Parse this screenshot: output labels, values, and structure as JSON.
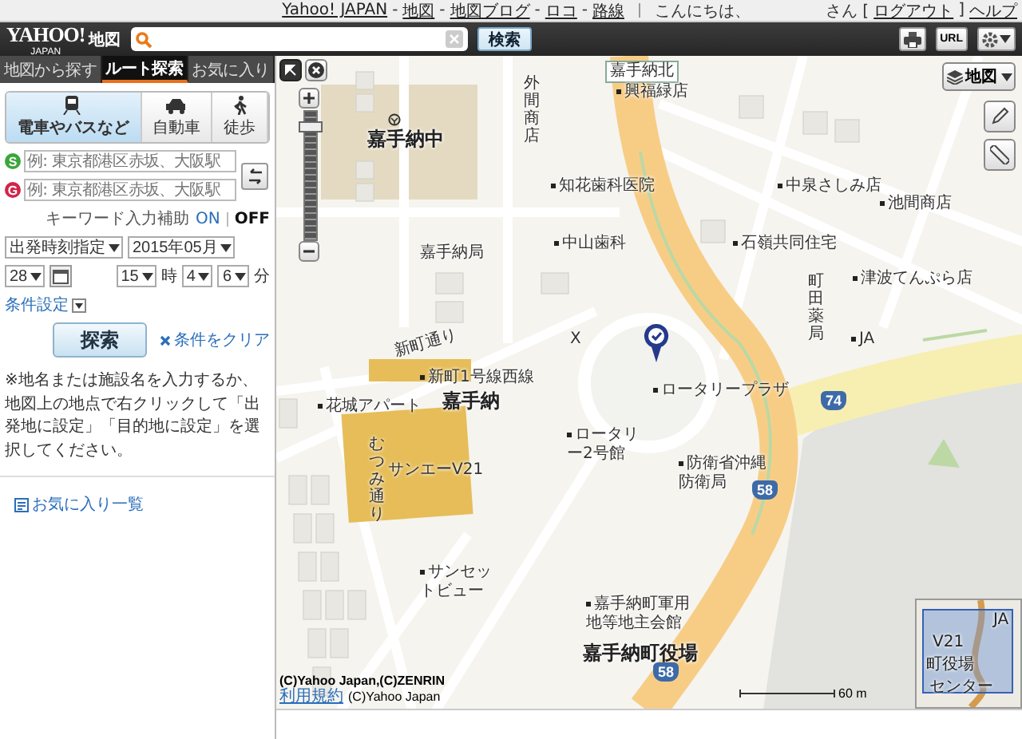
{
  "top_bar": {
    "links": [
      "Yahoo! JAPAN",
      "地図",
      "地図ブログ",
      "ロコ",
      "路線"
    ],
    "link_separator": "-",
    "greeting": "こんにちは、",
    "user_suffix": "さん [",
    "logout": "ログアウト",
    "after_logout": "]",
    "help": "ヘルプ"
  },
  "header": {
    "logo": "YAHOO!",
    "logo_sub": "JAPAN",
    "service": "地図",
    "search_button": "検索",
    "url_button": "URL"
  },
  "sidebar": {
    "tabs": [
      {
        "label": "地図から探す",
        "selected": false
      },
      {
        "label": "ルート探索",
        "selected": true
      },
      {
        "label": "お気に入り",
        "selected": false
      }
    ],
    "modes": [
      {
        "label": "電車やバスなど",
        "kind": "train",
        "selected": true
      },
      {
        "label": "自動車",
        "kind": "car",
        "selected": false
      },
      {
        "label": "徒歩",
        "kind": "walk",
        "selected": false
      }
    ],
    "origin": {
      "mark": "S",
      "placeholder": "例: 東京都港区赤坂、大阪駅"
    },
    "destination": {
      "mark": "G",
      "placeholder": "例: 東京都港区赤坂、大阪駅"
    },
    "keyword_assist": {
      "label": "キーワード入力補助",
      "options": [
        {
          "label": "ON",
          "selected": false
        },
        {
          "label": "OFF",
          "selected": true
        }
      ]
    },
    "time": {
      "mode": "出発時刻指定",
      "month": "2015年05月",
      "day": "28",
      "hour": "15",
      "hour_unit": "時",
      "minute_tens": "4",
      "minute_ones": "6",
      "minute_unit": "分"
    },
    "conditions_link": "条件設定",
    "search_button": "探索",
    "clear_link": "条件をクリア",
    "note": "※地名または施設名を入力するか、地図上の地点で右クリックして「出発地に設定」「目的地に設定」を選択してください。",
    "favorites_link": "お気に入り一覧"
  },
  "map": {
    "layer_button": "地図",
    "zoom": {
      "level": 0.92
    },
    "labels": [
      {
        "text": "嘉手納北",
        "kind": "sign"
      },
      {
        "text": "興福緑店",
        "kind": "poi"
      },
      {
        "text": "嘉手納中",
        "kind": "area"
      },
      {
        "text": "外間商店",
        "kind": "vertical"
      },
      {
        "text": "知花歯科医院",
        "kind": "poi"
      },
      {
        "text": "中泉さしみ店",
        "kind": "poi"
      },
      {
        "text": "池間商店",
        "kind": "poi"
      },
      {
        "text": "中山歯科",
        "kind": "poi"
      },
      {
        "text": "石嶺共同住宅",
        "kind": "poi"
      },
      {
        "text": "嘉手納局",
        "kind": "plain"
      },
      {
        "text": "町田薬局",
        "kind": "vertical"
      },
      {
        "text": "津波てんぷら店",
        "kind": "poi"
      },
      {
        "text": "JA",
        "kind": "poi"
      },
      {
        "text": "新町通り",
        "kind": "road"
      },
      {
        "text": "新町1号線西線",
        "kind": "poi"
      },
      {
        "text": "X",
        "kind": "plain"
      },
      {
        "text": "ロータリープラザ",
        "kind": "poi"
      },
      {
        "text": "花城アパート",
        "kind": "poi"
      },
      {
        "text": "嘉手納",
        "kind": "area"
      },
      {
        "text": "むつみ通り",
        "kind": "vertical"
      },
      {
        "text": "サンエーV21",
        "kind": "plain"
      },
      {
        "text": "ロータリー2号館",
        "kind": "poi"
      },
      {
        "text": "防衛省沖縄防衛局",
        "kind": "poi"
      },
      {
        "text": "サンセットビュー",
        "kind": "poi"
      },
      {
        "text": "嘉手納町軍用地等地主会館",
        "kind": "poi"
      },
      {
        "text": "嘉手納町役場",
        "kind": "area"
      }
    ],
    "shields": [
      "74",
      "58",
      "58"
    ],
    "minimap_labels": [
      "JA",
      "V21",
      "町役場",
      "センター"
    ],
    "copyright": "(C)Yahoo Japan,(C)ZENRIN",
    "terms_link": "利用規約",
    "copyright_2": "(C)Yahoo Japan",
    "scale": "60 m"
  }
}
